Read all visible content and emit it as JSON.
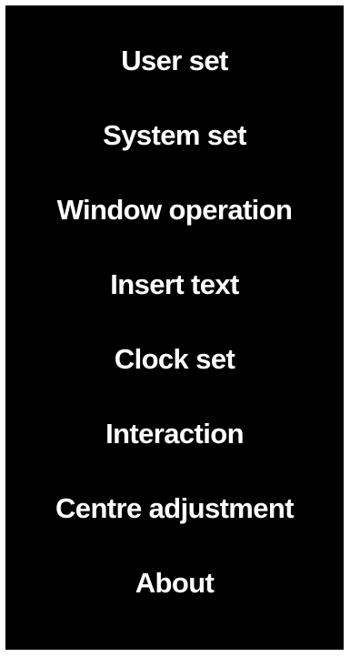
{
  "menu": {
    "items": [
      {
        "label": "User set"
      },
      {
        "label": "System set"
      },
      {
        "label": "Window operation"
      },
      {
        "label": "Insert text"
      },
      {
        "label": "Clock set"
      },
      {
        "label": "Interaction"
      },
      {
        "label": "Centre adjustment"
      },
      {
        "label": "About"
      }
    ]
  },
  "colors": {
    "background": "#000000",
    "text": "#ffffff",
    "border": "#ffffff"
  }
}
